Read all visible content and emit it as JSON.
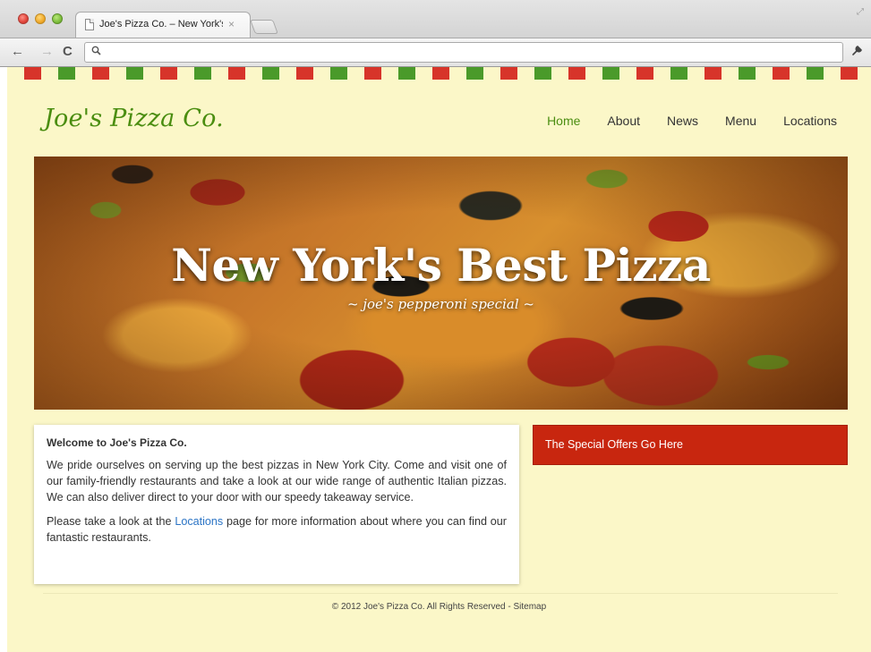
{
  "browser": {
    "tab_title": "Joe's Pizza Co. – New York's Best Pizza",
    "tab_close": "×",
    "omnibox_value": ""
  },
  "site": {
    "logo": "Joe's Pizza Co.",
    "nav": [
      {
        "label": "Home",
        "active": true
      },
      {
        "label": "About",
        "active": false
      },
      {
        "label": "News",
        "active": false
      },
      {
        "label": "Menu",
        "active": false
      },
      {
        "label": "Locations",
        "active": false
      }
    ],
    "hero": {
      "title": "New York's Best Pizza",
      "subtitle": "~ joe's pepperoni special ~"
    },
    "welcome": {
      "heading": "Welcome to Joe's Pizza Co.",
      "paragraph1": "We pride ourselves on serving up the best pizzas in New York City. Come and visit one of our family-friendly restaurants and take a look at our wide range of authentic Italian pizzas. We can also deliver direct to your door with our speedy takeaway service.",
      "paragraph2_before": "Please take a look at the ",
      "paragraph2_link": "Locations",
      "paragraph2_after": " page for more information about where you can find our fantastic restaurants."
    },
    "offers": {
      "text": "The Special Offers Go Here"
    },
    "footer": {
      "text": "© 2012 Joe's Pizza Co. All Rights Reserved - Sitemap"
    }
  },
  "colors": {
    "page_background": "#fbf7c8",
    "brand_green": "#4a8d10",
    "brand_red": "#c8260f",
    "link_blue": "#2b74c5"
  },
  "icons": [
    "document-icon",
    "back-arrow-icon",
    "forward-arrow-icon",
    "reload-icon",
    "search-icon",
    "wrench-icon"
  ]
}
